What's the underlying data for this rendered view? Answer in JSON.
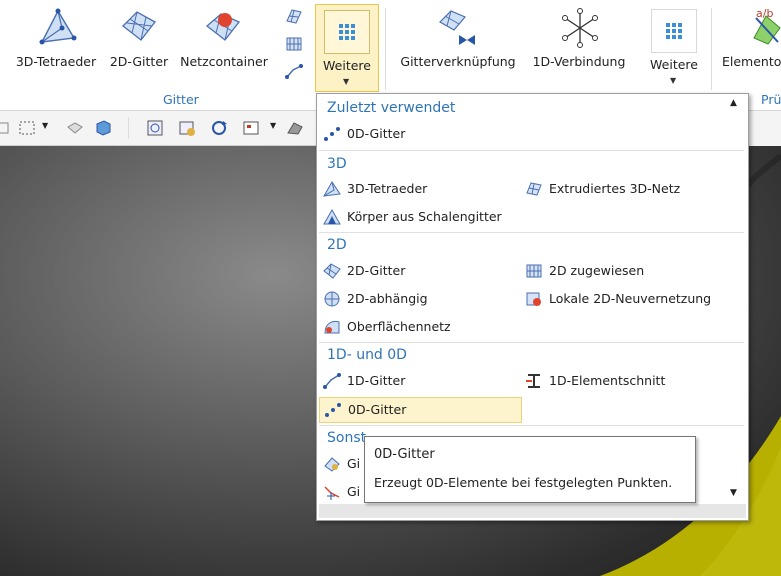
{
  "ribbon": {
    "buttons": {
      "tetra": "3D-Tetraeder",
      "gitter2d": "2D-Gitter",
      "netz": "Netzcontainer",
      "weitere1": "Weitere",
      "verkn": "Gitterverknüpfung",
      "verb1d": "1D-Verbindung",
      "weitere2": "Weitere",
      "element": "Elemento"
    },
    "groups": {
      "gitter": "Gitter",
      "pruef": "Prü"
    },
    "element_icon_text": "a/b"
  },
  "dropdown": {
    "sections": [
      {
        "title": "Zuletzt verwendet",
        "items": [
          "0D-Gitter"
        ]
      },
      {
        "title": "3D",
        "items": [
          "3D-Tetraeder",
          "Extrudiertes 3D-Netz",
          "Körper aus Schalengitter"
        ]
      },
      {
        "title": "2D",
        "items": [
          "2D-Gitter",
          "2D zugewiesen",
          "2D-abhängig",
          "Lokale 2D-Neuvernetzung",
          "Oberflächennetz"
        ]
      },
      {
        "title": "1D- und 0D",
        "items": [
          "1D-Gitter",
          "1D-Elementschnitt",
          "0D-Gitter"
        ]
      },
      {
        "title": "Sonst",
        "items": [
          "Gi",
          "Gi"
        ]
      }
    ]
  },
  "tooltip": {
    "title": "0D-Gitter",
    "description": "Erzeugt 0D-Elemente bei festgelegten Punkten."
  },
  "colors": {
    "accent": "#2e75b6",
    "highlight": "#fdf3cd",
    "viewport_yellow": "#b7b000"
  }
}
